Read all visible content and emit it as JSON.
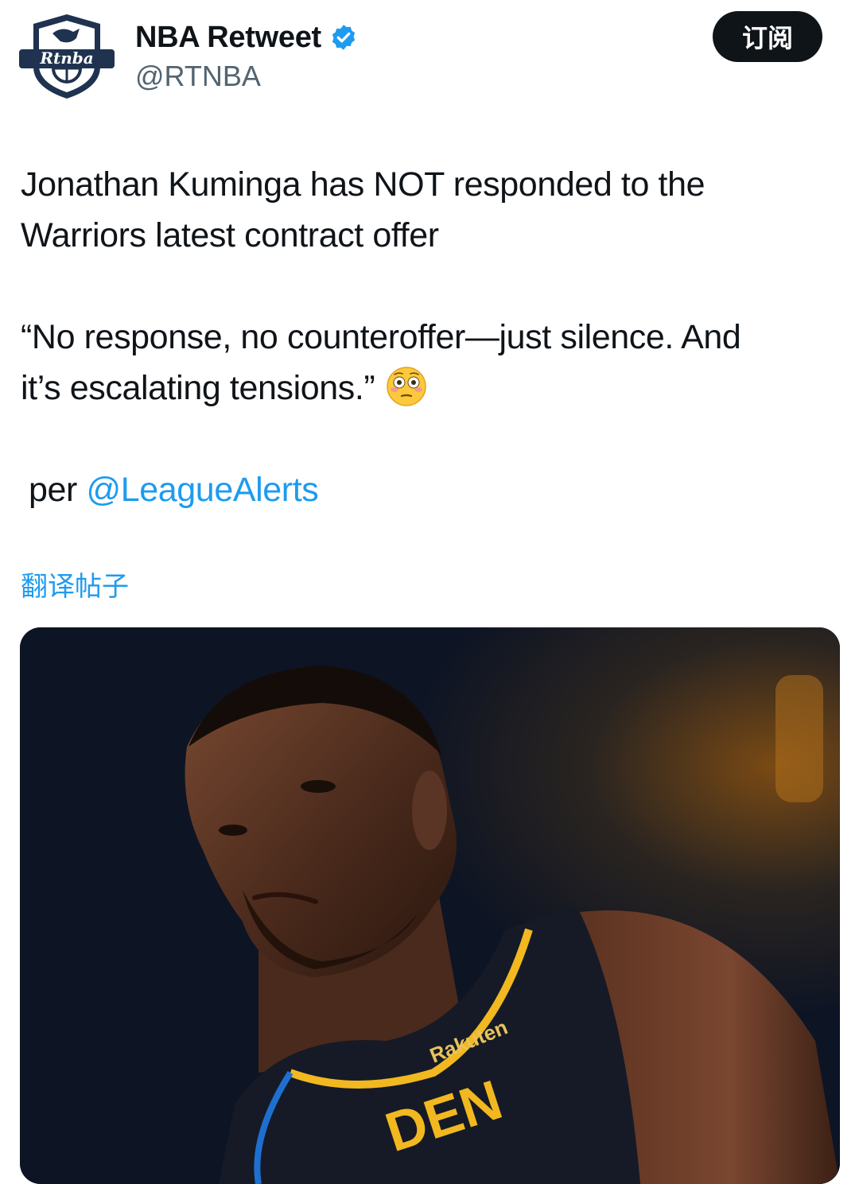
{
  "account": {
    "display_name": "NBA Retweet",
    "handle": "@RTNBA",
    "avatar_text": "Rtnba",
    "verified": true
  },
  "actions": {
    "subscribe_label": "订阅"
  },
  "tweet": {
    "line1": "Jonathan Kuminga has NOT responded to the",
    "line2": "Warriors latest contract offer",
    "quote_line1": "“No response, no counteroffer—just silence. And",
    "quote_line2": "it’s escalating tensions.”",
    "emoji": "flushed-face",
    "per_prefix": "per ",
    "mention": "@LeagueAlerts"
  },
  "translate": {
    "label": "翻译帖子"
  },
  "media": {
    "jersey_sponsor": "Rakuten",
    "jersey_text": "DEN"
  },
  "colors": {
    "accent": "#1d9bf0",
    "text": "#0f1419",
    "secondary": "#536471",
    "button_bg": "#0f1419",
    "jersey": "#151a26",
    "jersey_trim": "#f2b81f"
  }
}
